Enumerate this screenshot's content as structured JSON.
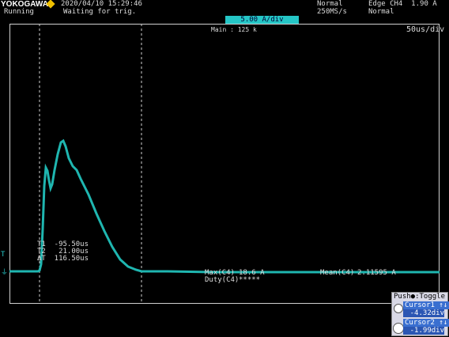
{
  "header": {
    "brand": "YOKOGAWA",
    "datetime": "2020/04/10 15:29:46",
    "status": "Running",
    "trigger_status": "Waiting for trig.",
    "acq_mode": "Normal",
    "sample_rate": "250MS/s",
    "trigger_condition": "Edge CH4  1.90 A",
    "trigger_mode": "Normal",
    "channel_scale": "5.00 A/div",
    "main_count": "Main : 125 k",
    "time_div": "50us/div"
  },
  "measurements": {
    "t1": "T1  -95.50us",
    "t2": "T2   21.00us",
    "dt": "ΔT  116.50us",
    "max_label": "Max(C4)",
    "max_value": "18.6 A",
    "duty_label": "Duty(C4)",
    "duty_value": "*****",
    "mean_label": "Mean(C4)",
    "mean_value": "2.11595 A"
  },
  "cursor_panel": {
    "push_toggle": "Push●:Toggle",
    "cursor1_label": "Cursor1 ↑↓",
    "cursor1_value": "-4.32div",
    "cursor2_label": "Cursor2 ↑↓",
    "cursor2_value": "-1.99div"
  },
  "markers": {
    "trigger_level": "T",
    "ground": "⏚"
  },
  "colors": {
    "trace": "#1fb6b0",
    "background": "#000000",
    "scale_badge": "#25c6c6"
  }
}
